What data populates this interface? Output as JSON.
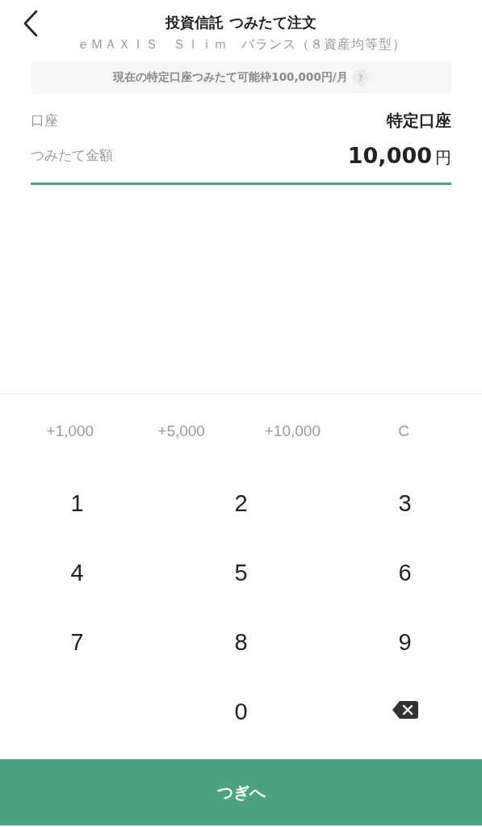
{
  "header": {
    "title": "投資信託 つみたて注文",
    "fund_name": "ｅＭＡＸＩＳ　Ｓｌｉｍ　バランス（８資産均等型）"
  },
  "limit_notice": {
    "text": "現在の特定口座つみたて可能枠100,000円/月",
    "help": "?"
  },
  "fields": [
    {
      "label": "口座",
      "value": "特定口座",
      "kind": "text"
    },
    {
      "label": "つみたて金額",
      "value": "10,000",
      "unit": "円",
      "kind": "amount"
    }
  ],
  "quick_amounts": [
    "+1,000",
    "+5,000",
    "+10,000",
    "C"
  ],
  "keys": [
    {
      "kind": "digit",
      "label": "1"
    },
    {
      "kind": "digit",
      "label": "2"
    },
    {
      "kind": "digit",
      "label": "3"
    },
    {
      "kind": "digit",
      "label": "4"
    },
    {
      "kind": "digit",
      "label": "5"
    },
    {
      "kind": "digit",
      "label": "6"
    },
    {
      "kind": "digit",
      "label": "7"
    },
    {
      "kind": "digit",
      "label": "8"
    },
    {
      "kind": "digit",
      "label": "9"
    },
    {
      "kind": "blank"
    },
    {
      "kind": "digit",
      "label": "0"
    },
    {
      "kind": "backspace"
    }
  ],
  "next_button": {
    "label": "つぎへ"
  }
}
